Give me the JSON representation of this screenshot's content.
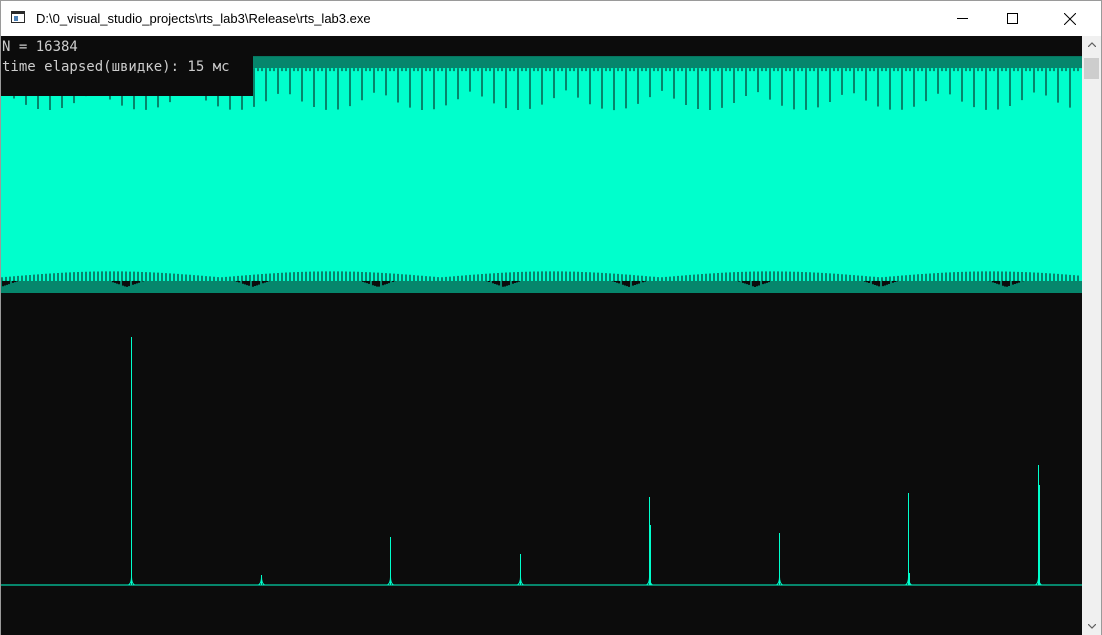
{
  "window": {
    "title": "D:\\0_visual_studio_projects\\rts_lab3\\Release\\rts_lab3.exe",
    "app_icon": "console-app-icon",
    "buttons": {
      "minimize": "minimize-icon",
      "maximize": "maximize-icon",
      "close": "close-icon"
    }
  },
  "console": {
    "line1": "N = 16384",
    "line2": "time elapsed(швидке): 15 мс"
  },
  "colors": {
    "signal": "#00ffcc",
    "background": "#0c0c0c",
    "console_text": "#cccccc"
  },
  "chart_data": [
    {
      "type": "area",
      "description_series": "signal",
      "x_range": [
        0,
        16384
      ],
      "band_top_level": 0.96,
      "band_bottom_level": 0.02,
      "grid": false
    },
    {
      "type": "bar",
      "description_series": "spectrum",
      "bins": [
        0,
        1,
        2,
        3,
        4,
        5,
        6,
        7
      ],
      "values": [
        248,
        10,
        48,
        31,
        88,
        52,
        92,
        120
      ],
      "secondary_values": [
        0,
        0,
        0,
        0,
        60,
        0,
        12,
        100
      ],
      "grid": false
    }
  ]
}
